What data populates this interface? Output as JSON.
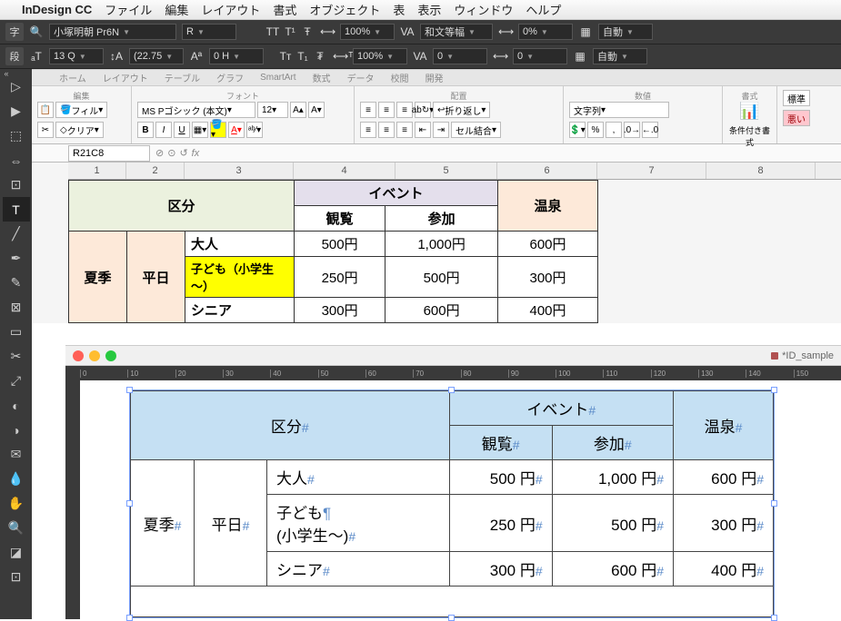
{
  "menubar": {
    "app": "InDesign CC",
    "items": [
      "ファイル",
      "編集",
      "レイアウト",
      "書式",
      "オブジェクト",
      "表",
      "表示",
      "ウィンドウ",
      "ヘルプ"
    ]
  },
  "idbar1": {
    "mode": "字",
    "font": "小塚明朝 Pr6N",
    "weight": "R",
    "size_pct1": "100%",
    "kern_label": "和文等幅",
    "track_pct": "0%",
    "auto": "自動"
  },
  "idbar2": {
    "mode": "段",
    "size": "13 Q",
    "leading": "(22.75 ",
    "baseline": "0 H",
    "size_pct2": "100%",
    "kern2": "0",
    "track2": "0",
    "auto": "自動"
  },
  "excel": {
    "tabs": [
      "ホーム",
      "レイアウト",
      "テーブル",
      "グラフ",
      "SmartArt",
      "数式",
      "データ",
      "校閲",
      "開発"
    ],
    "groups": {
      "edit": "編集",
      "font": "フォント",
      "align": "配置",
      "number": "数値",
      "format": "書式"
    },
    "fill_label": "フィル",
    "clear_label": "クリア",
    "font_name": "MS Pゴシック (本文)",
    "font_size": "12",
    "wrap_label": "折り返し",
    "merge_label": "セル結合",
    "num_format": "文字列",
    "cond_label": "条件付き書式",
    "style_normal": "標準",
    "style_bad": "悪い",
    "namebox": "R21C8",
    "fx": "fx"
  },
  "cols": [
    "1",
    "2",
    "3",
    "4",
    "5",
    "6",
    "7",
    "8"
  ],
  "xl": {
    "kubun": "区分",
    "event": "イベント",
    "onsen": "温泉",
    "kanran": "観覧",
    "sanka": "参加",
    "kaki": "夏季",
    "heijitsu": "平日",
    "otona": "大人",
    "kodomo": "子ども（小学生～）",
    "senior": "シニア",
    "r1": {
      "a": "500円",
      "b": "1,000円",
      "c": "600円"
    },
    "r2": {
      "a": "250円",
      "b": "500円",
      "c": "300円"
    },
    "r3": {
      "a": "300円",
      "b": "600円",
      "c": "400円"
    }
  },
  "idwin": {
    "title": "*ID_sample",
    "ruler": [
      "0",
      "10",
      "20",
      "30",
      "40",
      "50",
      "60",
      "70",
      "80",
      "90",
      "100",
      "110",
      "120",
      "130",
      "140",
      "150"
    ]
  },
  "idt": {
    "kubun": "区分",
    "event": "イベント",
    "onsen": "温泉",
    "kanran": "観覧",
    "sanka": "参加",
    "kaki": "夏季",
    "heijitsu": "平日",
    "otona": "大人",
    "kodomo1": "子ども",
    "kodomo2": "(小学生〜)",
    "senior": "シニア",
    "r1": {
      "a": "500 円",
      "b": "1,000 円",
      "c": "600 円"
    },
    "r2": {
      "a": "250 円",
      "b": "500 円",
      "c": "300 円"
    },
    "r3": {
      "a": "300 円",
      "b": "600 円",
      "c": "400 円"
    }
  },
  "tools": [
    "▲",
    "▶",
    "⇔",
    "⇕",
    "↔",
    "T",
    "／",
    "✎",
    "✐",
    "▭",
    "▦",
    "▤",
    "▥",
    "✂",
    "⬚",
    "◐",
    "⊕",
    "◉",
    "✋",
    "Q",
    "▣"
  ]
}
